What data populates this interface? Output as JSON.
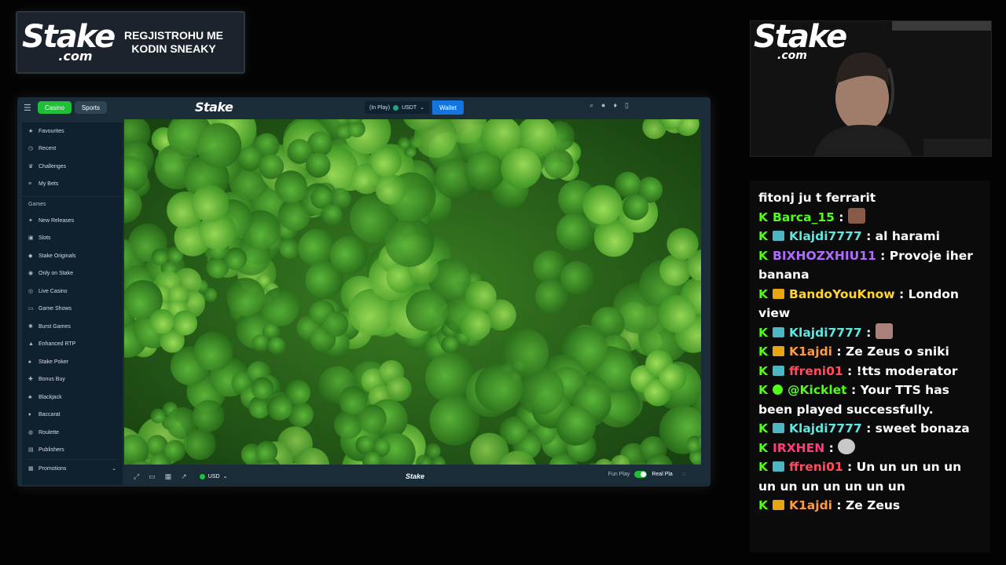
{
  "promo": {
    "logo_main": "Stake",
    "logo_sub": ".com",
    "text": "REGJISTROHU ME KODIN SNEAKY"
  },
  "browser": {
    "nav": {
      "casino_label": "Casino",
      "sports_label": "Sports",
      "brand": "Stake",
      "balance_label": "(In Play)",
      "currency": "USDT",
      "wallet_label": "Wallet"
    },
    "sidebar": {
      "top_items": [
        {
          "label": "Favourites",
          "icon": "star-icon"
        },
        {
          "label": "Recent",
          "icon": "clock-icon"
        },
        {
          "label": "Challenges",
          "icon": "trophy-icon"
        },
        {
          "label": "My Bets",
          "icon": "list-icon"
        }
      ],
      "games_heading": "Games",
      "game_items": [
        {
          "label": "New Releases",
          "icon": "sparkle-icon"
        },
        {
          "label": "Slots",
          "icon": "slots-icon"
        },
        {
          "label": "Stake Originals",
          "icon": "originals-icon"
        },
        {
          "label": "Only on Stake",
          "icon": "exclusive-icon"
        },
        {
          "label": "Live Casino",
          "icon": "live-icon"
        },
        {
          "label": "Game Shows",
          "icon": "tv-icon"
        },
        {
          "label": "Burst Games",
          "icon": "burst-icon"
        },
        {
          "label": "Enhanced RTP",
          "icon": "rtp-icon"
        },
        {
          "label": "Stake Poker",
          "icon": "poker-icon"
        },
        {
          "label": "Bonus Buy",
          "icon": "bonus-icon"
        },
        {
          "label": "Blackjack",
          "icon": "cards-icon"
        },
        {
          "label": "Baccarat",
          "icon": "baccarat-icon"
        },
        {
          "label": "Roulette",
          "icon": "roulette-icon"
        },
        {
          "label": "Publishers",
          "icon": "publishers-icon"
        }
      ],
      "promotions_label": "Promotions"
    },
    "gamebar": {
      "currency": "USD",
      "logo": "Stake",
      "fun_play": "Fun Play",
      "real_play": "Real Pla"
    }
  },
  "webcam": {
    "logo_main": "Stake",
    "logo_sub": ".com"
  },
  "chat": {
    "messages": [
      {
        "badges": [],
        "user": "",
        "text": "fitonj ju t ferrarit"
      },
      {
        "badges": [
          "kick"
        ],
        "user": "Barca_15",
        "text": "",
        "emote": "face"
      },
      {
        "badges": [
          "kick",
          "sub"
        ],
        "user": "Klajdi7777",
        "text": "al harami"
      },
      {
        "badges": [
          "kick"
        ],
        "user": "BIXHOZXHIU11",
        "text": "Provoje iher banana"
      },
      {
        "badges": [
          "kick",
          "crown"
        ],
        "user": "BandoYouKnow",
        "text": "London view"
      },
      {
        "badges": [
          "kick",
          "sub"
        ],
        "user": "Klajdi7777",
        "text": "",
        "emote": "face2"
      },
      {
        "badges": [
          "kick",
          "crown"
        ],
        "user": "K1ajdi",
        "text": "Ze Zeus o sniki"
      },
      {
        "badges": [
          "kick",
          "sub"
        ],
        "user": "ffreni01",
        "text": "!tts moderator"
      },
      {
        "badges": [
          "kick",
          "verified"
        ],
        "user": "@Kicklet",
        "text": "Your TTS has been played successfully."
      },
      {
        "badges": [
          "kick",
          "sub"
        ],
        "user": "Klajdi7777",
        "text": "sweet bonaza"
      },
      {
        "badges": [
          "kick"
        ],
        "user": "IRXHEN",
        "text": "",
        "emote": "ghost"
      },
      {
        "badges": [
          "kick",
          "sub"
        ],
        "user": "ffreni01",
        "text": "Un un un un un un un un un un un un"
      },
      {
        "badges": [
          "kick",
          "crown"
        ],
        "user": "K1ajdi",
        "text": "Ze Zeus"
      }
    ],
    "user_colors": {
      "Barca_15": "#53fc18",
      "Klajdi7777": "#5ee7e0",
      "BIXHOZXHIU11": "#b06cff",
      "BandoYouKnow": "#ffd52e",
      "K1ajdi": "#ff9b3d",
      "ffreni01": "#ff4d5e",
      "@Kicklet": "#53fc18",
      "IRXHEN": "#ff3b7a"
    }
  },
  "colors": {
    "stake_bg": "#1a2c38",
    "stake_sidebar": "#0f212e",
    "casino_green": "#1fbf3a",
    "wallet_blue": "#1475e1",
    "clover_green": "#3d8a22"
  }
}
